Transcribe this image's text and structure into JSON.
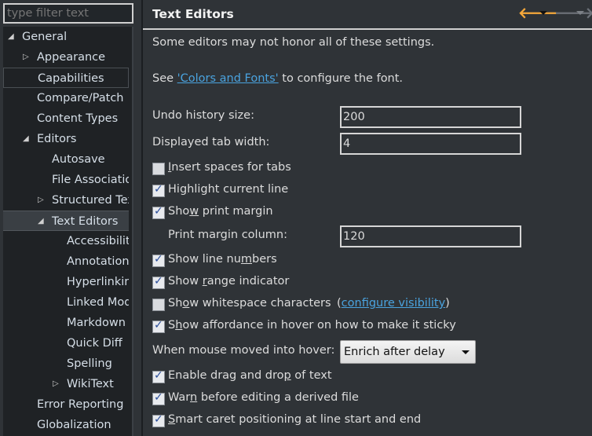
{
  "filter": {
    "placeholder": "type filter text"
  },
  "tree": [
    {
      "label": "General",
      "level": 0,
      "twisty": "expanded"
    },
    {
      "label": "Appearance",
      "level": 1,
      "twisty": "collapsed"
    },
    {
      "label": "Capabilities",
      "level": 1,
      "twisty": "none",
      "focused": true
    },
    {
      "label": "Compare/Patch",
      "level": 1,
      "twisty": "none"
    },
    {
      "label": "Content Types",
      "level": 1,
      "twisty": "none"
    },
    {
      "label": "Editors",
      "level": 1,
      "twisty": "expanded"
    },
    {
      "label": "Autosave",
      "level": 2,
      "twisty": "none"
    },
    {
      "label": "File Associations",
      "level": 2,
      "twisty": "none"
    },
    {
      "label": "Structured Text Editors",
      "level": 2,
      "twisty": "collapsed"
    },
    {
      "label": "Text Editors",
      "level": 2,
      "twisty": "expanded",
      "selected": true
    },
    {
      "label": "Accessibility",
      "level": 3,
      "twisty": "none"
    },
    {
      "label": "Annotations",
      "level": 3,
      "twisty": "none"
    },
    {
      "label": "Hyperlinking",
      "level": 3,
      "twisty": "none"
    },
    {
      "label": "Linked Mode",
      "level": 3,
      "twisty": "none"
    },
    {
      "label": "Markdown",
      "level": 3,
      "twisty": "none"
    },
    {
      "label": "Quick Diff",
      "level": 3,
      "twisty": "none"
    },
    {
      "label": "Spelling",
      "level": 3,
      "twisty": "none"
    },
    {
      "label": "WikiText",
      "level": 3,
      "twisty": "collapsed"
    },
    {
      "label": "Error Reporting",
      "level": 1,
      "twisty": "none"
    },
    {
      "label": "Globalization",
      "level": 1,
      "twisty": "none"
    }
  ],
  "page": {
    "title": "Text Editors",
    "back_icon": "arrow-left-icon",
    "forward_icon": "arrow-right-icon",
    "colors": {
      "back": "#f5a83a",
      "forward": "#6b7077",
      "link": "#4aa3df"
    },
    "note": "Some editors may not honor all of these settings.",
    "see_pre": "See ",
    "see_link": "'Colors and Fonts'",
    "see_post": " to configure the font.",
    "undo_label": "Undo history size:",
    "undo_value": "200",
    "tab_label": "Displayed tab width:",
    "tab_value": "4",
    "margin_label": "Print margin column:",
    "margin_value": "120",
    "hover_label": "When mouse moved into hover:",
    "hover_value": "Enrich after delay",
    "whitespace_link": "configure visibility",
    "options": [
      {
        "label": "Insert spaces for tabs",
        "checked": false,
        "mnemonic": 0
      },
      {
        "label": "Highlight current line",
        "checked": true,
        "mnemonic": 2
      },
      {
        "label": "Show print margin",
        "checked": true,
        "mnemonic": 3
      },
      {
        "label": "Show line numbers",
        "checked": true,
        "mnemonic": 12
      },
      {
        "label": "Show range indicator",
        "checked": true,
        "mnemonic": 5
      },
      {
        "label": "Show whitespace characters",
        "checked": false,
        "mnemonic": 2
      },
      {
        "label": "Show affordance in hover on how to make it sticky",
        "checked": true,
        "mnemonic": 1
      },
      {
        "label": "Enable drag and drop of text",
        "checked": true,
        "mnemonic": 19
      },
      {
        "label": "Warn before editing a derived file",
        "checked": true,
        "mnemonic": 3
      },
      {
        "label": "Smart caret positioning at line start and end",
        "checked": true,
        "mnemonic": 0
      }
    ]
  }
}
